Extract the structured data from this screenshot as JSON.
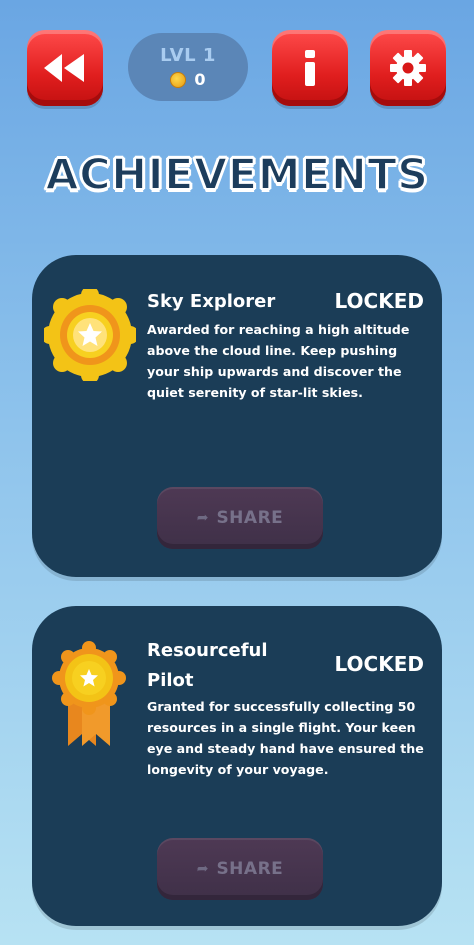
{
  "header": {
    "level_label": "LVL 1",
    "coins": "0",
    "back_icon": "rewind-icon",
    "info_icon": "info-icon",
    "settings_icon": "gear-icon",
    "accent_red": "#e01e1e"
  },
  "page": {
    "title": "ACHIEVEMENTS"
  },
  "achievements": [
    {
      "title": "Sky Explorer",
      "status": "LOCKED",
      "description": "Awarded for reaching a high altitude above the cloud line. Keep pushing your ship upwards and discover the quiet serenity of star-lit skies.",
      "badge_icon": "star-medal-icon",
      "share_label": "SHARE"
    },
    {
      "title": "Resourceful Pilot",
      "status": "LOCKED",
      "description": "Granted for successfully collecting 50 resources in a single flight. Your keen eye and steady hand have ensured the longevity of your voyage.",
      "badge_icon": "ribbon-medal-icon",
      "share_label": "SHARE"
    }
  ]
}
